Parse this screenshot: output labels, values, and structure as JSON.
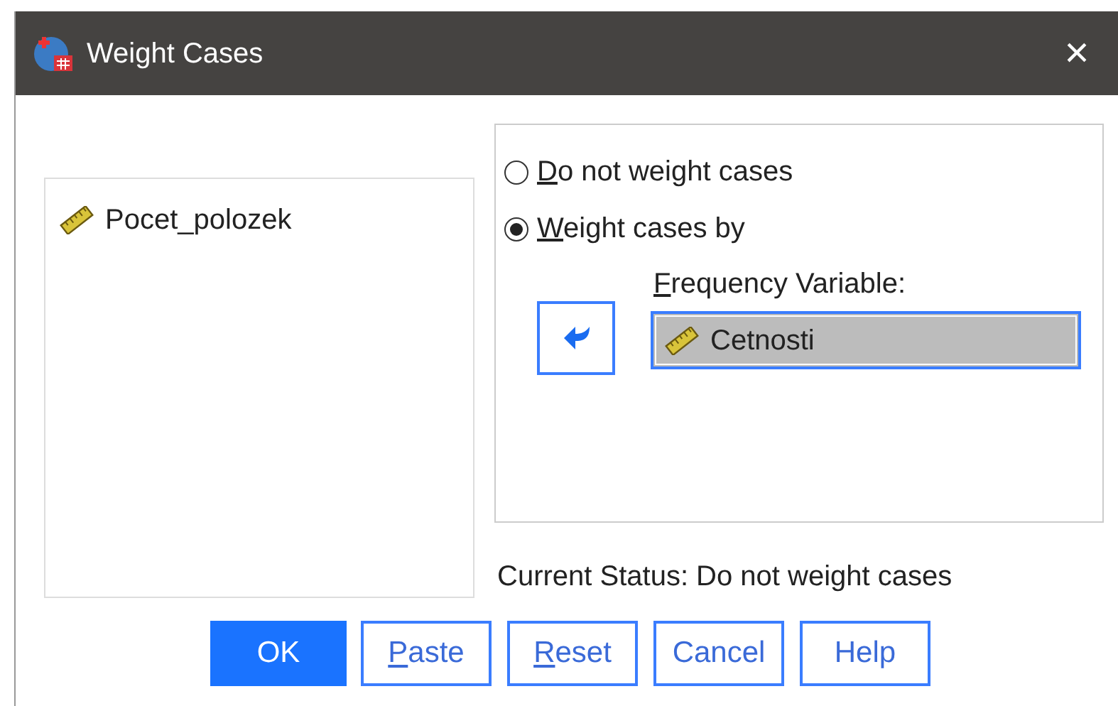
{
  "window": {
    "title": "Weight Cases",
    "close": "×"
  },
  "variables": [
    {
      "name": "Pocet_polozek",
      "selected": false
    }
  ],
  "options": [
    {
      "label": "Do not weight cases",
      "access_key_underlined": true,
      "selected": false
    },
    {
      "label": "Weight cases by",
      "access_key_underlined": true,
      "selected": true
    }
  ],
  "frequency_variable": {
    "label": "Frequency Variable:",
    "access_key_underlined": true,
    "value": "Cetnosti"
  },
  "status": "Current Status: Do not weight cases",
  "buttons": [
    {
      "label": "OK",
      "default": true,
      "access_key_underlined": false
    },
    {
      "label": "Paste",
      "default": false,
      "access_key_underlined": true
    },
    {
      "label": "Reset",
      "default": false,
      "access_key_underlined": true
    },
    {
      "label": "Cancel",
      "default": false,
      "access_key_underlined": false
    },
    {
      "label": "Help",
      "default": false,
      "access_key_underlined": false
    }
  ]
}
